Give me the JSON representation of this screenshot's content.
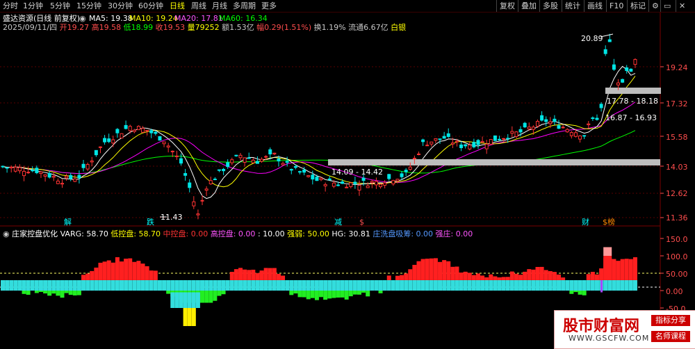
{
  "periods": [
    "分时",
    "1分钟",
    "5分钟",
    "15分钟",
    "30分钟",
    "60分钟",
    "日线",
    "周线",
    "月线",
    "多周期",
    "更多"
  ],
  "active_period": "日线",
  "tools": [
    "复权",
    "叠加",
    "多股",
    "统计",
    "画线",
    "F10",
    "标记"
  ],
  "title": {
    "stock": "盛达资源(日线 前复权)",
    "ma5": "MA5: 19.38",
    "ma10": "MA10: 19.24",
    "ma20": "MA20: 17.81",
    "ma60": "MA60: 16.34"
  },
  "quote": {
    "date": "2025/09/11/四",
    "open_l": "开",
    "open": "19.27",
    "high_l": "高",
    "high": "19.58",
    "low_l": "低",
    "low": "18.99",
    "close_l": "收",
    "close": "19.53",
    "vol_l": "量",
    "vol": "79252",
    "amt": "额1.53亿",
    "chg_l": "幅",
    "chg": "0.29(1.51%)",
    "turn": "换1.19%",
    "float": "流通6.67亿",
    "sector": "白银"
  },
  "y_axis": [
    "19.24",
    "17.32",
    "15.58",
    "14.03",
    "12.62",
    "11.36"
  ],
  "sub_axis": [
    "150.0",
    "100.0",
    "50.00",
    "0.00",
    "-50.0"
  ],
  "annotations": {
    "high": "20.89",
    "low": "11.43",
    "zone1": "17.78 - 18.18",
    "zone2": "16.87 - 16.93",
    "zone3": "14.09 - 14.42"
  },
  "events": [
    "解",
    "跌",
    "减",
    "$",
    "财",
    "$榜"
  ],
  "indicator": {
    "name": "庄家控盘优化",
    "varg": "VARG: 58.70",
    "low": "低控盘: 58.70",
    "mid": "中控盘: 0.00",
    "high": "高控盘: 0.00",
    "ten": ": 10.00",
    "strong": "强弱: 50.00",
    "hg": "HG: 30.81",
    "wash": "庄洗盘吸筹: 0.00",
    "zq": "强庄: 0.00"
  },
  "watermark": {
    "site": "股市财富网",
    "url": "WWW.GSCFW.COM",
    "tag1": "指标分享",
    "tag2": "名师课程"
  },
  "colors": {
    "up": "#ff3333",
    "down": "#00e5e5",
    "ma5": "#ffffff",
    "ma10": "#ffff00",
    "ma20": "#ff00ff",
    "ma60": "#00ff00"
  },
  "chart_data": {
    "type": "candlestick",
    "y_range": [
      11.0,
      21.2
    ],
    "sub_range": [
      -50,
      150
    ]
  }
}
